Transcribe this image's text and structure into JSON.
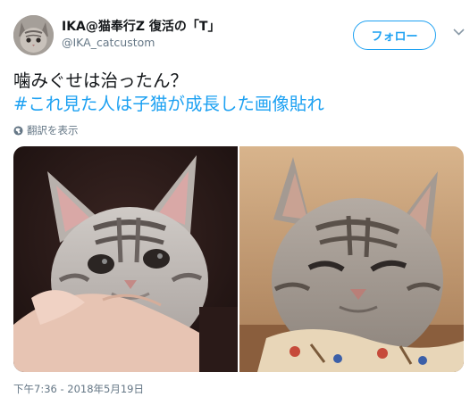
{
  "user": {
    "display_name": "IKA@猫奉行Z 復活の「T」",
    "handle": "@IKA_catcustom",
    "avatar_icon": "cat-avatar"
  },
  "follow_button": {
    "label": "フォロー"
  },
  "tweet": {
    "text_line1": "噛みぐせは治ったん？",
    "hashtag": "#これ見た人は子猫が成長した画像貼れ"
  },
  "translate": {
    "label": "翻訳を表示",
    "icon": "globe-icon"
  },
  "media": {
    "photos": [
      {
        "icon": "kitten-photo"
      },
      {
        "icon": "adult-cat-photo"
      }
    ]
  },
  "timestamp": "下午7:36 - 2018年5月19日",
  "colors": {
    "accent": "#1da1f2",
    "text": "#14171a",
    "secondary": "#657786"
  }
}
